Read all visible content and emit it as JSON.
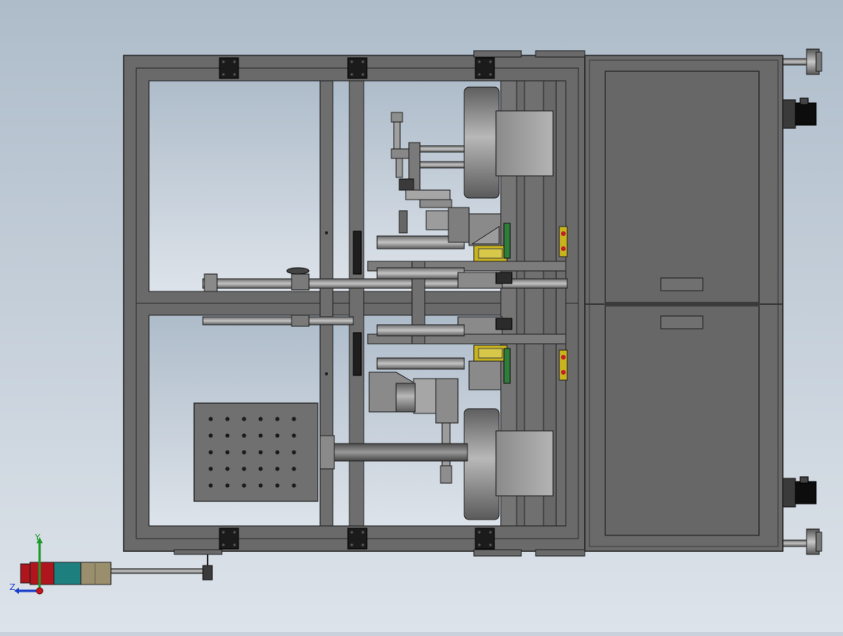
{
  "viewport": {
    "background_top": "#aebcca",
    "background_bottom": "#dde3ea"
  },
  "model": {
    "frame_color": "#6b6b6b",
    "frame_edge": "#2b2b2b",
    "cabinet_color": "#666666",
    "steel_light": "#a9a9a9",
    "steel_dark": "#5a5a5a",
    "bracket_color": "#1c1c1c",
    "accent_green": "#2f7d3a",
    "accent_yellow": "#c9b41e",
    "accent_red": "#c0202a",
    "stack_light_colors": [
      "#b0141c",
      "#1e7f7f",
      "#9a8f6c"
    ]
  },
  "triad": {
    "y_label": "Y",
    "z_label": "Z",
    "y_color": "#1e9a2a",
    "z_color": "#1a3fc8",
    "x_color": "#c8141c"
  }
}
